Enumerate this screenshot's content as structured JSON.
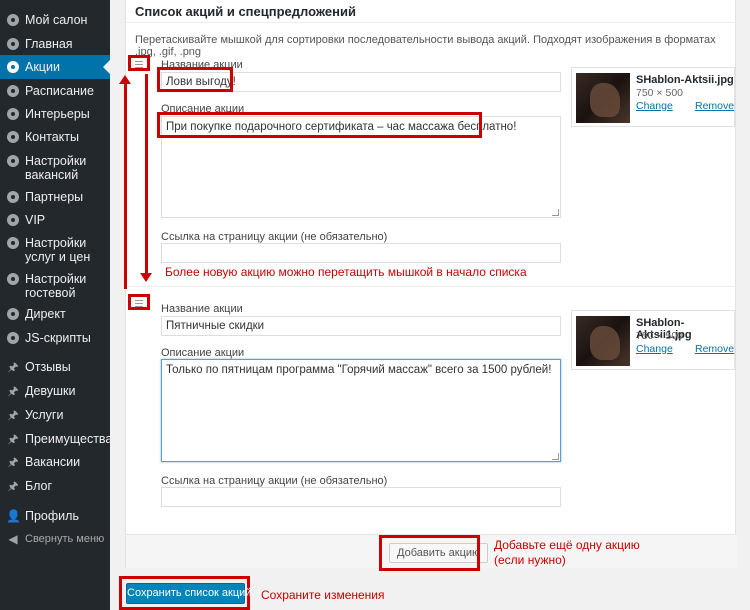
{
  "sidebar": {
    "items": [
      {
        "label": "Мой салон",
        "icon": "gear-icon"
      },
      {
        "label": "Главная",
        "icon": "gear-icon"
      },
      {
        "label": "Акции",
        "icon": "gear-icon",
        "active": true
      },
      {
        "label": "Расписание",
        "icon": "gear-icon"
      },
      {
        "label": "Интерьеры",
        "icon": "gear-icon"
      },
      {
        "label": "Контакты",
        "icon": "gear-icon"
      },
      {
        "label": "Настройки вакансий",
        "icon": "gear-icon"
      },
      {
        "label": "Партнеры",
        "icon": "gear-icon"
      },
      {
        "label": "VIP",
        "icon": "gear-icon"
      },
      {
        "label": "Настройки услуг и цен",
        "icon": "gear-icon"
      },
      {
        "label": "Настройки гостевой",
        "icon": "gear-icon"
      },
      {
        "label": "Директ",
        "icon": "gear-icon"
      },
      {
        "label": "JS-скрипты",
        "icon": "gear-icon"
      },
      {
        "label": "Отзывы",
        "icon": "pin-icon"
      },
      {
        "label": "Девушки",
        "icon": "pin-icon"
      },
      {
        "label": "Услуги",
        "icon": "pin-icon"
      },
      {
        "label": "Преимущества",
        "icon": "pin-icon"
      },
      {
        "label": "Вакансии",
        "icon": "pin-icon"
      },
      {
        "label": "Блог",
        "icon": "pin-icon"
      },
      {
        "label": "Профиль",
        "icon": "user-icon"
      },
      {
        "label": "Свернуть меню",
        "icon": "collapse-icon"
      }
    ]
  },
  "panel": {
    "title": "Список акций и спецпредложений",
    "hint": "Перетаскивайте мышкой для сортировки последовательности вывода акций. Подходят изображения в форматах .jpg, .gif, .png"
  },
  "promos": [
    {
      "name_label": "Название акции",
      "name_value": "Лови выгоду!",
      "desc_label": "Описание акции",
      "desc_value": "При покупке подарочного сертификата – час массажа бесплатно!",
      "link_label": "Ссылка на страницу акции (не обязательно)",
      "link_value": "",
      "image": {
        "filename": "SHablon-Aktsii.jpg",
        "size": "750 × 500",
        "change": "Change",
        "remove": "Remove"
      }
    },
    {
      "name_label": "Название акции",
      "name_value": "Пятничные скидки",
      "desc_label": "Описание акции",
      "desc_value": "Только по пятницам программа \"Горячий массаж\" всего за 1500 рублей!",
      "link_label": "Ссылка на страницу акции (не обязательно)",
      "link_value": "",
      "image": {
        "filename": "SHablon-Aktsii1.jpg",
        "size": "750 × 500",
        "change": "Change",
        "remove": "Remove"
      }
    }
  ],
  "buttons": {
    "add": "Добавить акцию",
    "save": "Сохранить список акций"
  },
  "annotations": {
    "drag": "Более новую акцию можно перетащить мышкой в начало списка",
    "add_line1": "Добавьте ещё одну акцию",
    "add_line2": "(если нужно)",
    "save": "Сохраните изменения"
  },
  "colors": {
    "sidebar_bg": "#23282d",
    "active_bg": "#0073aa",
    "primary_button": "#0085ba",
    "annotation_red": "#cc0000",
    "link": "#0073aa"
  }
}
